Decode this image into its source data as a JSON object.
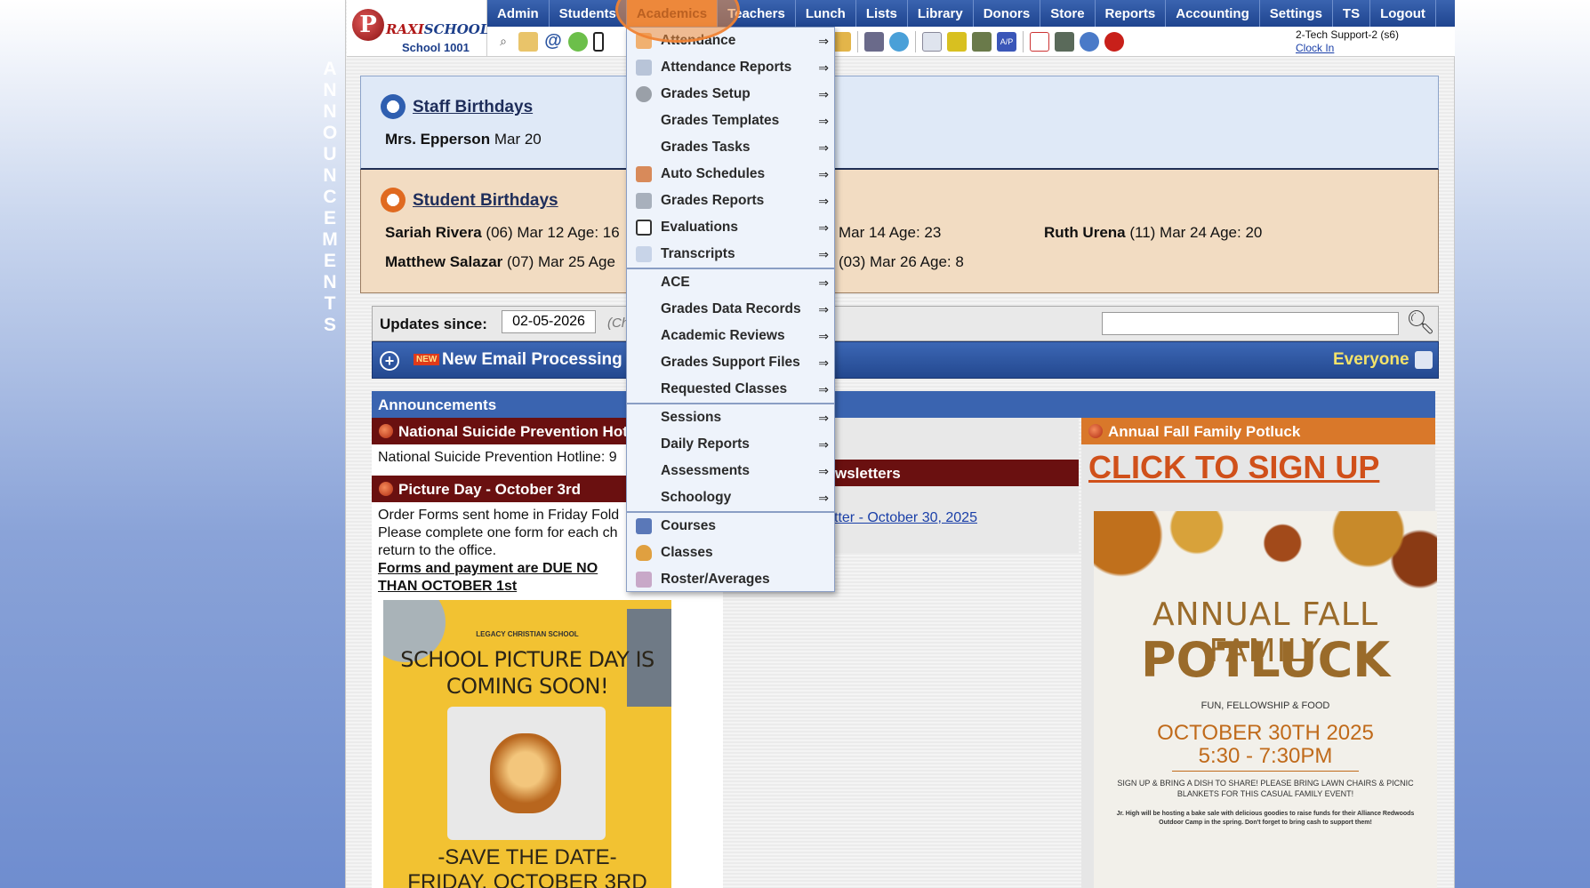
{
  "sidebar": {
    "vertical_label_letters": [
      "A",
      "N",
      "N",
      "O",
      "U",
      "N",
      "C",
      "E",
      "M",
      "E",
      "N",
      "T",
      "S"
    ]
  },
  "logo": {
    "brand_letter": "P",
    "brand_prefix": "RAXI",
    "brand_suffix": "SCHOOL",
    "school_label": "School 1001"
  },
  "topnav": {
    "items": [
      {
        "label": "Admin"
      },
      {
        "label": "Students"
      },
      {
        "label": "Academics"
      },
      {
        "label": "Teachers"
      },
      {
        "label": "Lunch"
      },
      {
        "label": "Lists"
      },
      {
        "label": "Library"
      },
      {
        "label": "Donors"
      },
      {
        "label": "Store"
      },
      {
        "label": "Reports"
      },
      {
        "label": "Accounting"
      },
      {
        "label": "Settings"
      },
      {
        "label": "TS"
      },
      {
        "label": "Logout"
      }
    ],
    "active": "Academics"
  },
  "toolbar": {
    "icons": [
      "magnifier-icon",
      "calendar-icon",
      "email-at-icon",
      "chat-icon",
      "phone-icon",
      "lunch-icon",
      "book-icon",
      "bell-icon",
      "envelope-arrow-icon",
      "people-icon",
      "clock-icon",
      "document-icon",
      "card-icon",
      "printer-icon",
      "ap-icon",
      "pdf-icon",
      "stack-icon",
      "help-icon",
      "power-icon"
    ],
    "user_text": "2-Tech Support-2 (s6)",
    "clock_link": "Clock In"
  },
  "academics_menu": {
    "items": [
      {
        "label": "Attendance",
        "icon": "calendar-icon"
      },
      {
        "label": "Attendance Reports",
        "icon": "report-icon"
      },
      {
        "label": "Grades Setup",
        "icon": "gear-icon"
      },
      {
        "label": "Grades Templates",
        "icon": ""
      },
      {
        "label": "Grades Tasks",
        "icon": ""
      },
      {
        "label": "Auto Schedules",
        "icon": "schedule-icon"
      },
      {
        "label": "Grades Reports",
        "icon": "printer-icon"
      },
      {
        "label": "Evaluations",
        "icon": "checkbox-icon"
      },
      {
        "label": "Transcripts",
        "icon": "scroll-icon"
      },
      {
        "label": "ACE",
        "icon": ""
      },
      {
        "label": "Grades Data Records",
        "icon": ""
      },
      {
        "label": "Academic Reviews",
        "icon": ""
      },
      {
        "label": "Grades Support Files",
        "icon": ""
      },
      {
        "label": "Requested Classes",
        "icon": ""
      },
      {
        "label": "Sessions",
        "icon": ""
      },
      {
        "label": "Daily Reports",
        "icon": ""
      },
      {
        "label": "Assessments",
        "icon": ""
      },
      {
        "label": "Schoology",
        "icon": ""
      },
      {
        "label": "Courses",
        "icon": "book-icon"
      },
      {
        "label": "Classes",
        "icon": "person-icon"
      },
      {
        "label": "Roster/Averages",
        "icon": "roster-icon"
      }
    ],
    "submenu_arrow": "⇒"
  },
  "birthdays": {
    "staff_title": "Staff Birthdays",
    "staff": [
      {
        "name": "Mrs. Epperson",
        "detail": "Mar 20"
      }
    ],
    "student_title": "Student Birthdays",
    "students": [
      {
        "name": "Sariah Rivera",
        "detail": "(06) Mar 12 Age: 16"
      },
      {
        "name": "",
        "detail": "Mar 14 Age: 23"
      },
      {
        "name": "Ruth Urena",
        "detail": "(11) Mar 24 Age: 20"
      },
      {
        "name": "Matthew Salazar",
        "detail": "(07) Mar 25 Age"
      },
      {
        "name": "",
        "detail": "(03) Mar 26 Age: 8"
      }
    ]
  },
  "updates": {
    "label": "Updates since:",
    "date_value": "02-05-2026",
    "hint": "(Ch",
    "search_value": ""
  },
  "email_bar": {
    "new_badge": "NEW",
    "title": "New Email Processing",
    "audience": "Everyone"
  },
  "announcements": {
    "header": "Announcements",
    "left": [
      {
        "title": "National Suicide Prevention Hotli",
        "lines": [
          "National Suicide Prevention Hotline: 9"
        ]
      },
      {
        "title": "Picture Day - October 3rd",
        "lines": [
          "Order Forms sent home in Friday Fold",
          "Please complete one form for each ch",
          "return to the office."
        ],
        "emphasis": [
          "Forms and payment are DUE NO",
          "THAN OCTOBER 1st"
        ]
      }
    ],
    "mid": [
      {
        "title": "wsletters",
        "link": "tter - October 30, 2025"
      }
    ],
    "right": {
      "title": "Annual Fall Family Potluck",
      "cta": "CLICK TO SIGN UP"
    }
  },
  "flyer_picture": {
    "school_name": "LEGACY CHRISTIAN SCHOOL",
    "headline_1": "SCHOOL PICTURE DAY IS",
    "headline_2": "COMING SOON!",
    "save_1": "-SAVE THE DATE-",
    "save_2": "FRIDAY, OCTOBER 3RD"
  },
  "flyer_potluck": {
    "h1": "ANNUAL FALL FAMILY",
    "h2": "POTLUCK",
    "tag": "FUN, FELLOWSHIP & FOOD",
    "date_line_1": "OCTOBER 30TH 2025",
    "date_line_2": "5:30 - 7:30PM",
    "sign": "SIGN UP & BRING A DISH TO SHARE! PLEASE BRING LAWN CHAIRS & PICNIC BLANKETS FOR THIS CASUAL FAMILY EVENT!",
    "bake": "Jr. High will be hosting a bake sale with delicious goodies to raise funds for their Alliance Redwoods Outdoor Camp in the spring. Don't forget to bring cash to support them!"
  },
  "colors": {
    "nav_blue": "#2a54a0",
    "active_orange": "#e8833a",
    "dark_red": "#6a1010",
    "potluck_orange": "#d9782a"
  }
}
